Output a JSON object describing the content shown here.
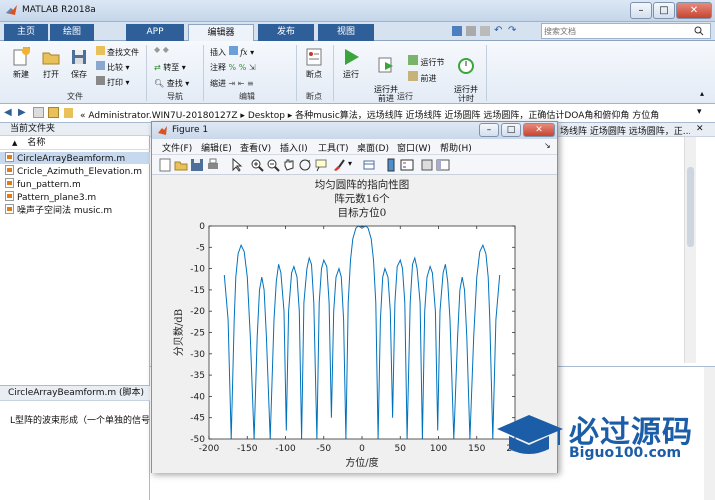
{
  "window": {
    "title": "MATLAB R2018a"
  },
  "tabs": [
    "主页",
    "绘图",
    "APP",
    "编辑器",
    "发布",
    "视图"
  ],
  "search": {
    "placeholder": "搜索文档"
  },
  "ribbon": {
    "new": "新建",
    "open": "打开",
    "save": "保存",
    "find_files": "查找文件",
    "compare": "比较",
    "print": "打印",
    "goto": "转至",
    "find": "查找",
    "insert": "插入",
    "comment": "注释",
    "indent": "缩进",
    "breakpoints": "断点",
    "run": "运行",
    "run_advance": "运行并\n前进",
    "run_section": "运行节",
    "advance": "前进",
    "run_time": "运行并\n计时",
    "groups": {
      "file": "文件",
      "nav": "导航",
      "edit": "编辑",
      "breakpoints": "断点",
      "run": "运行"
    }
  },
  "path": {
    "text": "« Administrator.WIN7U-20180127Z ▸ Desktop ▸ 各种music算法，远场线阵 近场线阵 近场圆阵 远场圆阵，正确估计DOA角和俯仰角 方位角"
  },
  "current_folder": {
    "title": "当前文件夹",
    "column": "名称",
    "sort_arrow": "▲",
    "files": [
      "CircleArrayBeamform.m",
      "Cricle_Azimuth_Elevation.m",
      "fun_pattern.m",
      "Pattern_plane3.m",
      "噪声子空间法 music.m"
    ],
    "details_title": "CircleArrayBeamform.m (脚本)",
    "details_text": "L型阵的波束形成（一个单独的信号）"
  },
  "editor_bg": {
    "tab_text": "场线阵 近场圆阵 远场圆阵，正..."
  },
  "figure": {
    "title": "Figure 1",
    "menu": [
      "文件(F)",
      "编辑(E)",
      "查看(V)",
      "插入(I)",
      "工具(T)",
      "桌面(D)",
      "窗口(W)",
      "帮助(H)"
    ],
    "plot_title_lines": [
      "均匀圆阵的指向性图",
      "阵元数16个",
      "目标方位0"
    ]
  },
  "watermark": {
    "text1": "必过源码",
    "text2": "Biguo100.com"
  },
  "chart_data": {
    "type": "line",
    "title": "均匀圆阵的指向性图 / 阵元数16个 / 目标方位0",
    "xlabel": "方位/度",
    "ylabel": "分贝数/dB",
    "xlim": [
      -200,
      200
    ],
    "ylim": [
      -50,
      0
    ],
    "xticks": [
      -200,
      -150,
      -100,
      -50,
      0,
      50,
      100,
      150,
      200
    ],
    "yticks": [
      0,
      -5,
      -10,
      -15,
      -20,
      -25,
      -30,
      -35,
      -40,
      -45,
      -50
    ],
    "series": [
      {
        "color": "#0072bd",
        "x": [
          -180,
          -175,
          -171,
          -167,
          -165,
          -162,
          -158,
          -154,
          -150,
          -146,
          -141,
          -137,
          -134,
          -131,
          -128,
          -125,
          -120,
          -115,
          -112,
          -109,
          -106,
          -102,
          -99,
          -96,
          -92,
          -89,
          -85,
          -82,
          -79,
          -76,
          -72,
          -69,
          -66,
          -63,
          -59,
          -56,
          -53,
          -50,
          -46,
          -43,
          -40,
          -37,
          -34,
          -30,
          -27,
          -24,
          -21,
          -18,
          -15,
          -12,
          -8,
          -5,
          -2,
          0,
          2,
          5,
          8,
          12,
          15,
          18,
          21,
          24,
          27,
          30,
          34,
          37,
          40,
          43,
          46,
          50,
          53,
          56,
          59,
          63,
          66,
          69,
          72,
          76,
          79,
          82,
          85,
          89,
          92,
          96,
          99,
          102,
          106,
          109,
          112,
          115,
          120,
          125,
          128,
          131,
          134,
          137,
          141,
          146,
          150,
          154,
          158,
          162,
          165,
          167,
          171,
          175,
          180
        ],
        "y": [
          -11.5,
          -22,
          -50,
          -22,
          -12,
          -6.5,
          -4.5,
          -6,
          -12,
          -26,
          -50,
          -26,
          -15,
          -12,
          -15,
          -26,
          -50,
          -22,
          -13,
          -9,
          -11,
          -20,
          -48,
          -20,
          -11,
          -9.5,
          -12,
          -20,
          -50,
          -18,
          -10,
          -7.5,
          -9,
          -18,
          -50,
          -18,
          -10,
          -8,
          -9.5,
          -18,
          -45,
          -20,
          -12,
          -10,
          -12,
          -22,
          -50,
          -18,
          -8,
          -3,
          -0.5,
          0,
          -0.3,
          0,
          -0.3,
          0,
          -0.5,
          -3,
          -8,
          -18,
          -50,
          -22,
          -12,
          -10,
          -12,
          -20,
          -45,
          -18,
          -9.5,
          -8,
          -10,
          -18,
          -50,
          -18,
          -9,
          -7.5,
          -10,
          -18,
          -50,
          -20,
          -12,
          -9.5,
          -11,
          -20,
          -48,
          -20,
          -11,
          -9,
          -13,
          -22,
          -50,
          -26,
          -15,
          -12,
          -15,
          -26,
          -50,
          -26,
          -12,
          -6,
          -4.5,
          -6.5,
          -12,
          -22,
          -50,
          -22,
          -11.5
        ]
      }
    ]
  }
}
